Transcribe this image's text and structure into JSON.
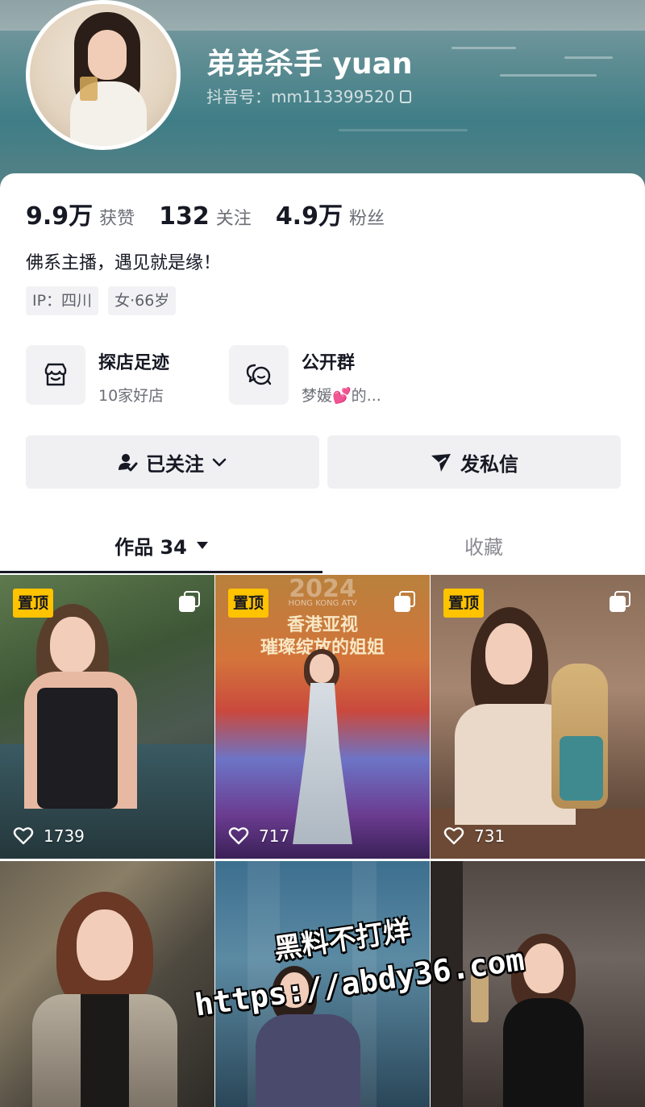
{
  "profile": {
    "nickname": "弟弟杀手 yuan",
    "douyin_id": "抖音号：mm113399520"
  },
  "stats": [
    {
      "value": "9.9万",
      "label": "获赞"
    },
    {
      "value": "132",
      "label": "关注"
    },
    {
      "value": "4.9万",
      "label": "粉丝"
    }
  ],
  "bio": "佛系主播，遇见就是缘！",
  "tags": [
    "IP：四川",
    "女·66岁"
  ],
  "features": [
    {
      "title": "探店足迹",
      "subtitle": "10家好店",
      "icon": "storefront-icon"
    },
    {
      "title": "公开群",
      "subtitle": "梦媛💕的...",
      "icon": "group-chat-icon"
    }
  ],
  "buttons": {
    "follow_label": "已关注",
    "message_label": "发私信"
  },
  "tabs": {
    "works_label": "作品 34",
    "favorites_label": "收藏"
  },
  "videos": [
    {
      "pinned": true,
      "pin_label": "置顶",
      "likes": "1739",
      "multi": true
    },
    {
      "pinned": true,
      "pin_label": "置顶",
      "likes": "717",
      "multi": true,
      "overlay_lines": [
        "2024",
        "HONG KONG ATV",
        "香港亚视",
        "璀璨绽放的姐姐"
      ]
    },
    {
      "pinned": true,
      "pin_label": "置顶",
      "likes": "731",
      "multi": true
    },
    {
      "pinned": false
    },
    {
      "pinned": false
    },
    {
      "pinned": false
    }
  ],
  "watermark": {
    "line1": "黑料不打烊",
    "line2": "https://abdy36.com"
  },
  "colors": {
    "pin_badge": "#ffc300",
    "primary_text": "#161823",
    "secondary_text": "#6d6f77",
    "button_bg": "#f0f0f2"
  }
}
